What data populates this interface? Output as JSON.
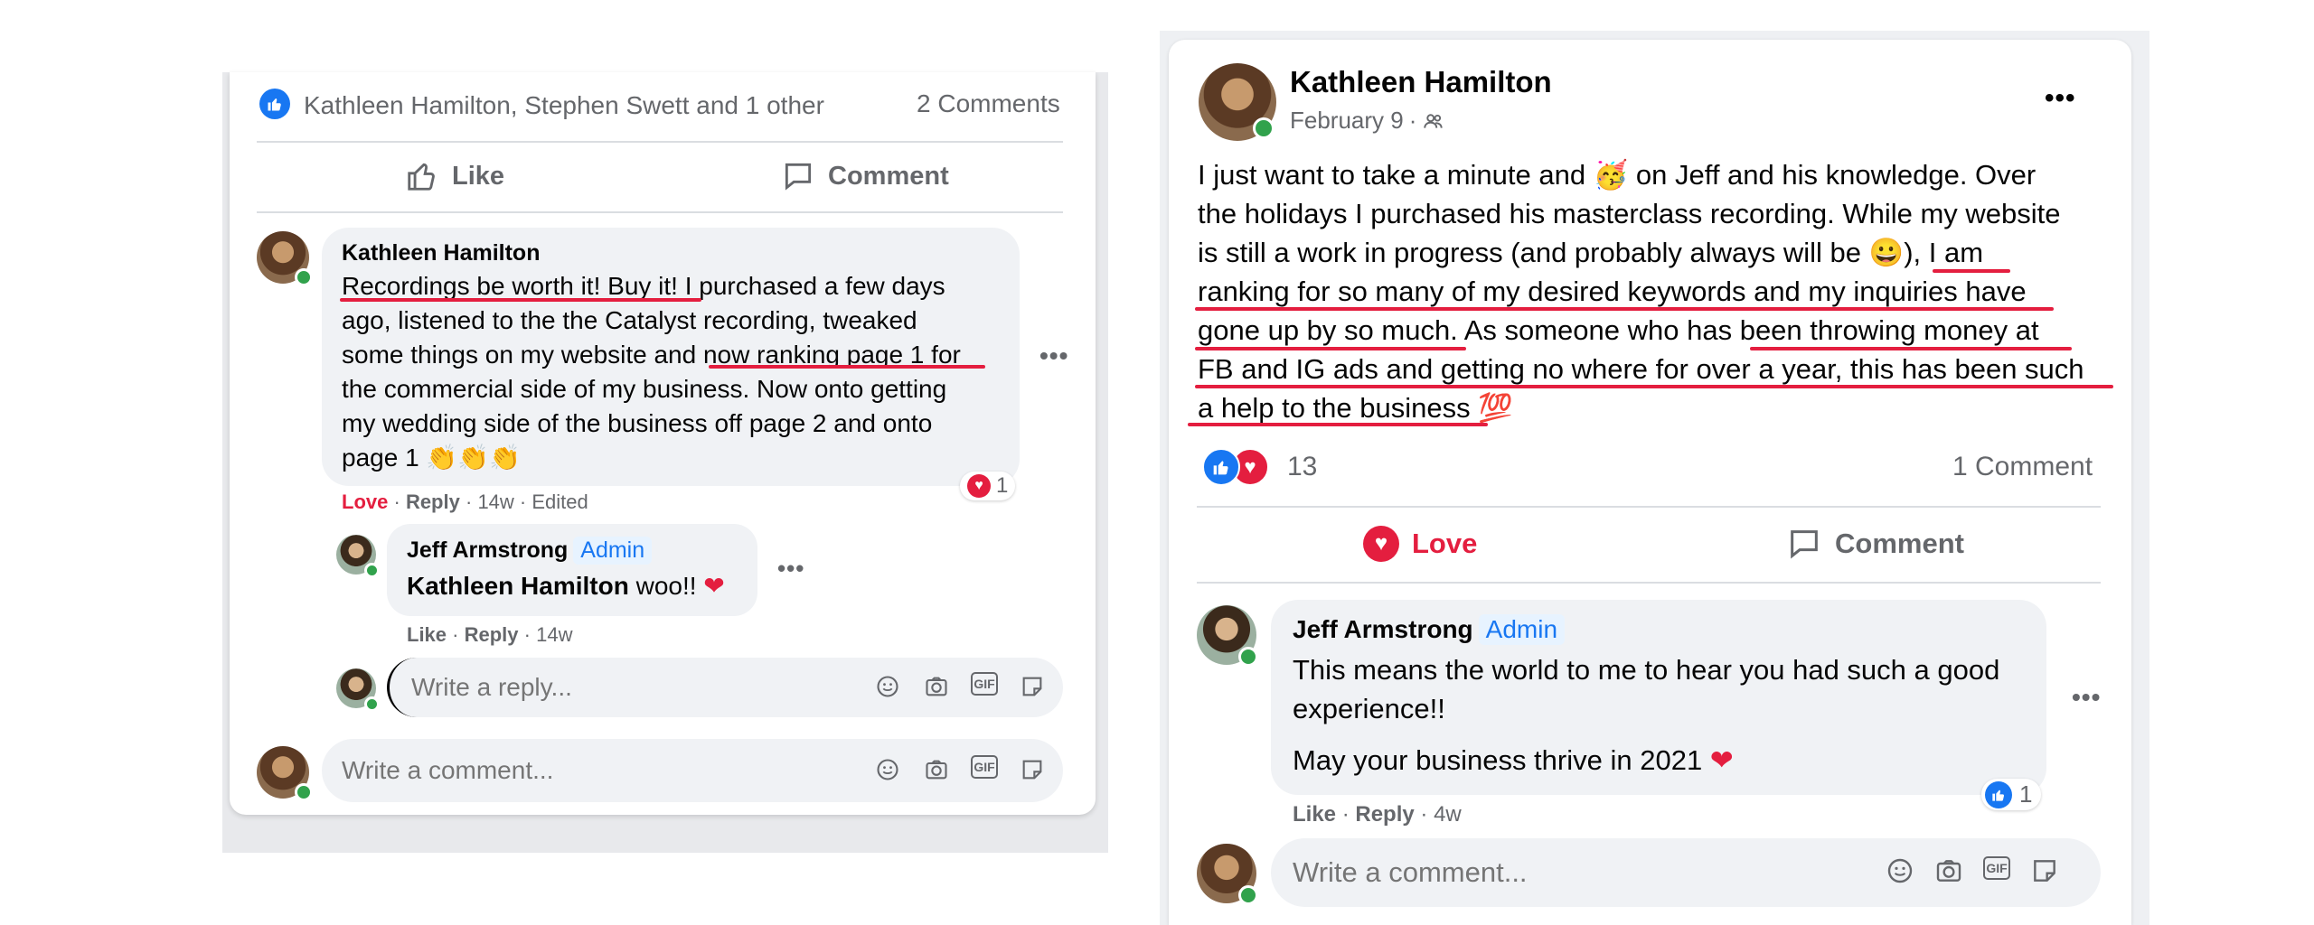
{
  "left": {
    "reactors": "Kathleen Hamilton, Stephen Swett and 1 other",
    "comments_count": "2 Comments",
    "actions": {
      "like": "Like",
      "comment": "Comment"
    },
    "comment": {
      "author": "Kathleen Hamilton",
      "line1": "Recordings be worth it! Buy it!",
      "line1b": " I purchased a few days",
      "line2": "ago, listened to the the Catalyst recording, tweaked",
      "line3a": "some things on my website and ",
      "line3b": "now ranking page 1 for",
      "line4": "the commercial side of my business. Now onto getting",
      "line5": "my wedding side of the business off page 2 and onto",
      "line6": "page 1",
      "emojis": "👏👏👏",
      "reaction_label": "Love",
      "reply_label": "Reply",
      "time": "14w",
      "edited": "Edited",
      "reaction_count": "1"
    },
    "reply": {
      "author": "Jeff Armstrong",
      "badge": "Admin",
      "mention": "Kathleen Hamilton",
      "text": " woo!!",
      "heart": "❤",
      "like_label": "Like",
      "reply_label": "Reply",
      "time": "14w"
    },
    "reply_placeholder": "Write a reply...",
    "comment_placeholder": "Write a comment..."
  },
  "right": {
    "author": "Kathleen Hamilton",
    "date": "February 9",
    "post_lines": [
      "I just want to take a minute and ",
      " on Jeff and his knowledge. Over",
      "the holidays I purchased his masterclass recording. While my website",
      "is still a work in progress (and probably always will be ",
      "), I am",
      "ranking for so many of my desired keywords and my inquiries have",
      "gone up by so much. As someone who has been throwing money at",
      "FB and IG ads and getting no where for over a year, this has been such",
      "a help to the business "
    ],
    "emoji_party": "🥳",
    "emoji_grin": "😀",
    "emoji_100": "💯",
    "reaction_count": "13",
    "comments_count": "1 Comment",
    "actions": {
      "love": "Love",
      "comment": "Comment"
    },
    "reply": {
      "author": "Jeff Armstrong",
      "badge": "Admin",
      "line1": "This means the world to me to hear you had such a good",
      "line2": "experience!!",
      "line3": "May your business thrive in 2021 ",
      "heart": "❤",
      "like_label": "Like",
      "reply_label": "Reply",
      "time": "4w",
      "reaction_count": "1"
    },
    "comment_placeholder": "Write a comment..."
  },
  "colors": {
    "accent": "#1877f2",
    "love": "#e41e3f",
    "underline": "#e41e3f",
    "online": "#31a24c"
  }
}
